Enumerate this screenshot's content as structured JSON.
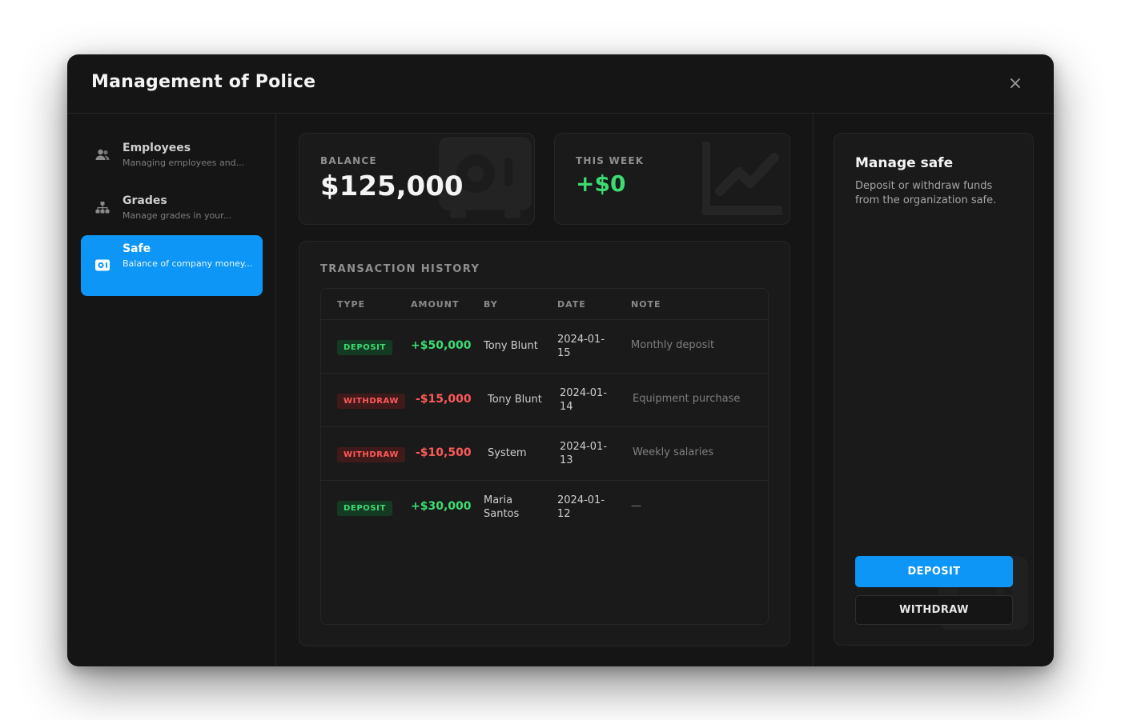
{
  "window": {
    "title": "Management of Police",
    "close_icon": "×"
  },
  "sidebar": {
    "items": [
      {
        "label": "Employees",
        "description": "Managing employees and...",
        "icon": "users-icon"
      },
      {
        "label": "Grades",
        "description": "Manage grades in your...",
        "icon": "hierarchy-icon"
      },
      {
        "label": "Safe",
        "description": "Balance of company money...",
        "icon": "safe-icon",
        "active": true
      }
    ]
  },
  "stats": {
    "balance": {
      "label": "BALANCE",
      "value": "$125,000"
    },
    "week": {
      "label": "THIS WEEK",
      "value": "+$0"
    }
  },
  "transactions": {
    "title": "TRANSACTION HISTORY",
    "headers": [
      "TYPE",
      "AMOUNT",
      "BY",
      "DATE",
      "NOTE"
    ],
    "rows": [
      {
        "type": "DEPOSIT",
        "amount": "+$50,000",
        "by": "Tony Blunt",
        "date_line1": "2024-01-",
        "date_line2": "15",
        "note": "Monthly deposit"
      },
      {
        "type": "WITHDRAW",
        "amount": "-$15,000",
        "by": "Tony Blunt",
        "date_line1": "2024-01-",
        "date_line2": "14",
        "note": "Equipment purchase"
      },
      {
        "type": "WITHDRAW",
        "amount": "-$10,500",
        "by": "System",
        "date_line1": "2024-01-",
        "date_line2": "13",
        "note": "Weekly salaries"
      },
      {
        "type": "DEPOSIT",
        "amount": "+$30,000",
        "by_line1": "Maria",
        "by_line2": "Santos",
        "date_line1": "2024-01-",
        "date_line2": "12",
        "note": "—"
      }
    ]
  },
  "manage": {
    "title": "Manage safe",
    "description": "Deposit or withdraw funds from the organization safe.",
    "deposit_label": "DEPOSIT",
    "withdraw_label": "WITHDRAW"
  },
  "colors": {
    "accent": "#0d96f5",
    "positive": "#3ddc72",
    "negative": "#ff5a5a",
    "background": "#151515"
  }
}
